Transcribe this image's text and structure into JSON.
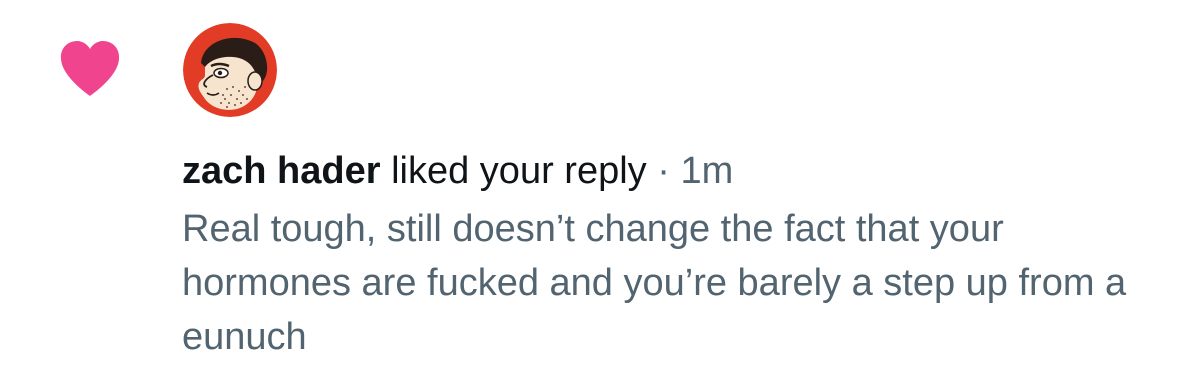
{
  "notification": {
    "type_icon": "heart-icon",
    "accent_color": "#f0448f",
    "avatar_icon": "cartoon-face-avatar",
    "actor_name": "zach hader",
    "action_text": "liked your reply",
    "separator": "·",
    "timestamp": "1m",
    "reply_text": "Real tough, still doesn’t change the fact that your hormones are fucked and you’re barely a step up from a eunuch"
  }
}
